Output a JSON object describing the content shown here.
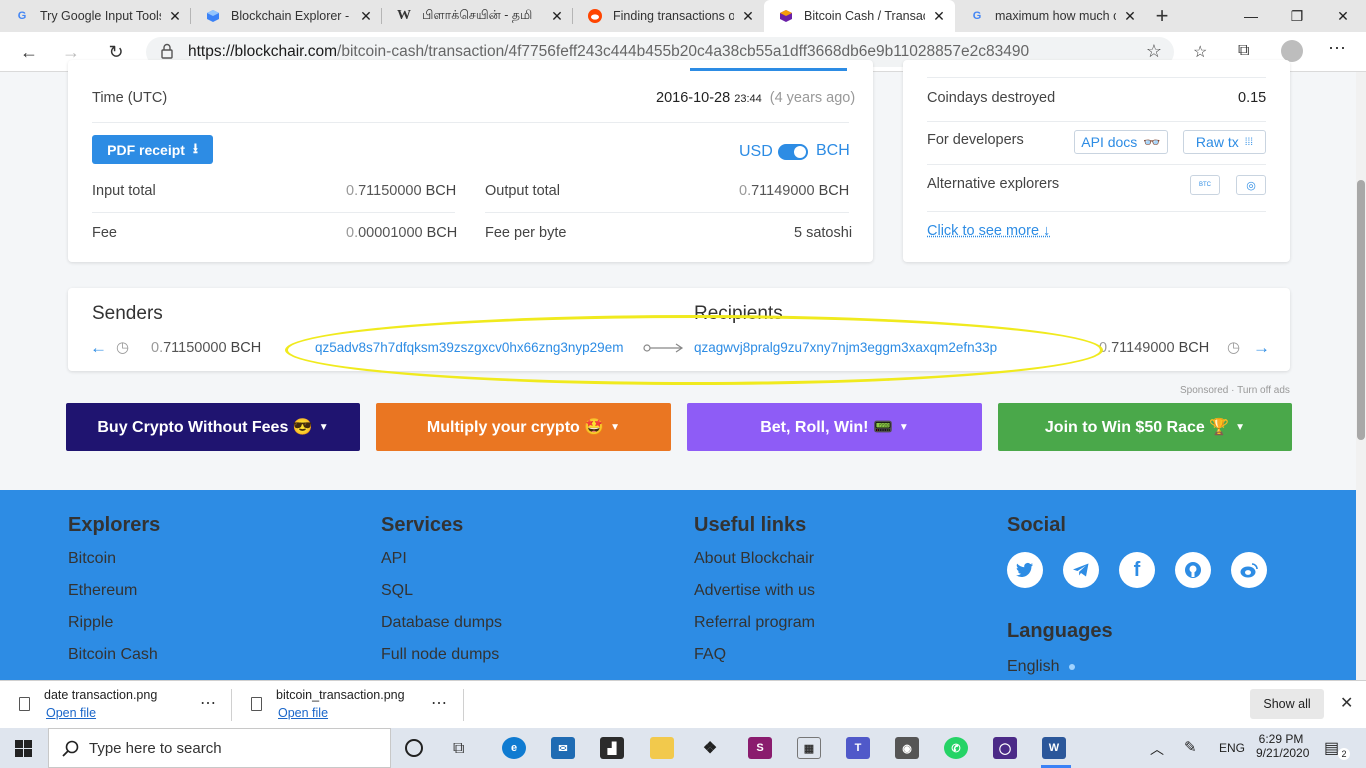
{
  "browser": {
    "tabs": [
      {
        "title": "Try Google Input Tools o",
        "favicon": "G"
      },
      {
        "title": "Blockchain Explorer - Se",
        "favicon": "blockchair-cube"
      },
      {
        "title": "பிளாக்செயின் - தமி",
        "favicon": "W"
      },
      {
        "title": "Finding transactions on",
        "favicon": "reddit"
      },
      {
        "title": "Bitcoin Cash / Transactio",
        "favicon": "bch-cube"
      },
      {
        "title": "maximum how much ca",
        "favicon": "G"
      }
    ],
    "url": {
      "host": "https://blockchair.com",
      "path": "/bitcoin-cash/transaction/4f7756feff243c444b455b20c4a38cb55a1dff3668db6e9b11028857e2c83490"
    }
  },
  "tx": {
    "time_label": "Time (UTC)",
    "time_date": "2016-10-28",
    "time_clock": "23:44",
    "time_ago": "(4 years ago)",
    "pdf_label": "PDF receipt",
    "currency_left": "USD",
    "currency_right": "BCH",
    "input_total_label": "Input total",
    "input_total_main": "0.",
    "input_total_value": "71150000",
    "input_total_unit": "BCH",
    "output_total_label": "Output total",
    "output_total_main": "0.",
    "output_total_value": "71149000",
    "output_total_unit": "BCH",
    "fee_label": "Fee",
    "fee_main": "0.",
    "fee_value": "00001000",
    "fee_unit": "BCH",
    "fee_per_byte_label": "Fee per byte",
    "fee_per_byte_value": "5 satoshi"
  },
  "side": {
    "coindays_label": "Coindays destroyed",
    "coindays_value": "0.15",
    "dev_label": "For developers",
    "api_docs": "API docs",
    "raw_tx": "Raw tx",
    "alt_label": "Alternative explorers",
    "alt_badge": "BTC",
    "see_more": "Click to see more"
  },
  "flow": {
    "senders_title": "Senders",
    "recipients_title": "Recipients",
    "sender_amount_main": "0.",
    "sender_amount": "71150000",
    "sender_unit": "BCH",
    "sender_address": "qz5adv8s7h7dfqksm39zszgxcv0hx66zng3nyp29em",
    "recipient_address": "qzagwvj8pralg9zu7xny7njm3eggm3xaxqm2efn33p",
    "recipient_amount_main": "0.",
    "recipient_amount": "71149000",
    "recipient_unit": "BCH"
  },
  "ads": {
    "sponsored": "Sponsored · Turn off ads",
    "items": [
      {
        "label": "Buy Crypto Without Fees 😎",
        "color": "#1f1470"
      },
      {
        "label": "Multiply your crypto 🤩",
        "color": "#ea7622"
      },
      {
        "label": "Bet, Roll, Win! 📟",
        "color": "#8e5cf6"
      },
      {
        "label": "Join to Win $50 Race 🏆",
        "color": "#4aa84a"
      }
    ]
  },
  "footer": {
    "explorers": {
      "title": "Explorers",
      "links": [
        "Bitcoin",
        "Ethereum",
        "Ripple",
        "Bitcoin Cash"
      ]
    },
    "services": {
      "title": "Services",
      "links": [
        "API",
        "SQL",
        "Database dumps",
        "Full node dumps"
      ]
    },
    "useful": {
      "title": "Useful links",
      "links": [
        "About Blockchair",
        "Advertise with us",
        "Referral program",
        "FAQ"
      ]
    },
    "social": {
      "title": "Social",
      "icons": [
        "twitter-icon",
        "telegram-icon",
        "facebook-icon",
        "github-icon",
        "weibo-icon"
      ]
    },
    "languages": {
      "title": "Languages",
      "current": "English"
    }
  },
  "downloads": {
    "items": [
      {
        "name": "date transaction.png",
        "open": "Open file"
      },
      {
        "name": "bitcoin_transaction.png",
        "open": "Open file"
      }
    ],
    "show_all": "Show all"
  },
  "taskbar": {
    "search_placeholder": "Type here to search",
    "lang": "ENG",
    "time": "6:29 PM",
    "date": "9/21/2020",
    "notifications": "2"
  },
  "colors": {
    "accent": "#2d8ce4",
    "highlight": "#f0ea1e"
  }
}
